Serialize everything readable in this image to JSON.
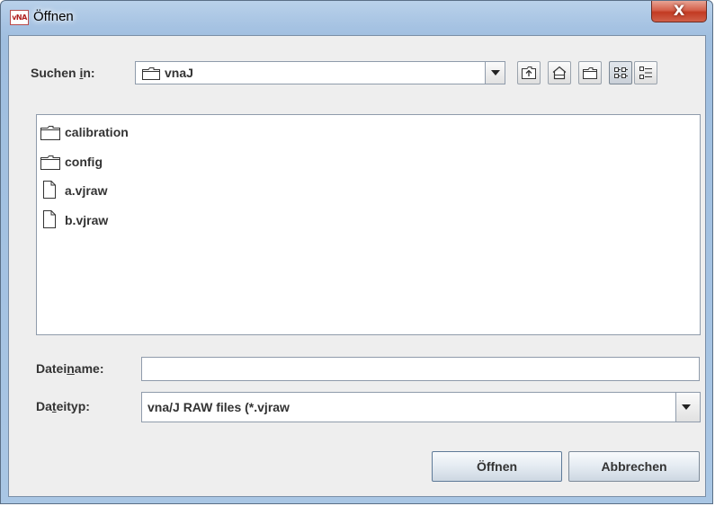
{
  "window": {
    "title": "Öffnen",
    "app_icon_text": "vNA",
    "close_glyph": "X"
  },
  "look_in": {
    "label_pre": "Suchen ",
    "label_mnemonic": "i",
    "label_post": "n:",
    "value": "vnaJ",
    "icon": "folder-icon"
  },
  "toolbar": {
    "buttons": [
      {
        "name": "up-one-level",
        "icon": "folder-up-icon"
      },
      {
        "name": "home",
        "icon": "home-icon"
      },
      {
        "name": "new-folder",
        "icon": "new-folder-icon"
      },
      {
        "name": "list-view",
        "icon": "list-view-icon",
        "selected": true
      },
      {
        "name": "details-view",
        "icon": "details-view-icon",
        "selected": false
      }
    ]
  },
  "files": [
    {
      "name": "calibration",
      "type": "folder",
      "icon": "folder-icon"
    },
    {
      "name": "config",
      "type": "folder",
      "icon": "folder-icon"
    },
    {
      "name": "a.vjraw",
      "type": "file",
      "icon": "file-icon"
    },
    {
      "name": "b.vjraw",
      "type": "file",
      "icon": "file-icon"
    }
  ],
  "filename": {
    "label_pre": "Datei",
    "label_mnemonic": "n",
    "label_post": "ame:",
    "value": ""
  },
  "filetype": {
    "label_pre": "Da",
    "label_mnemonic": "t",
    "label_post": "eityp:",
    "value": "vna/J RAW files (*.vjraw"
  },
  "buttons": {
    "open": "Öffnen",
    "cancel": "Abbrechen"
  }
}
